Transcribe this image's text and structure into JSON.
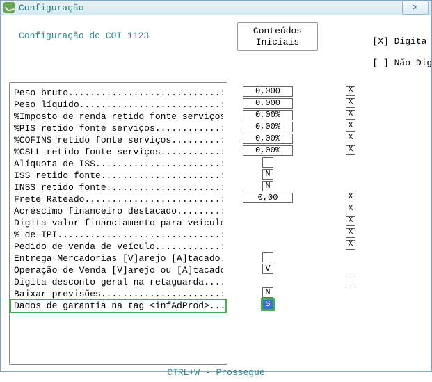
{
  "window": {
    "title": "Configuração",
    "close_glyph": "✕"
  },
  "page_title": "Configuração do COI 1123",
  "column_headers": {
    "conteudos_line1": "Conteúdos",
    "conteudos_line2": "Iniciais",
    "legend_line1": "[X] Digita",
    "legend_line2": "[ ] Não Digita"
  },
  "rows": [
    {
      "label": "Peso bruto............................:",
      "value": "0,000",
      "value_kind": "wide",
      "flag": "X"
    },
    {
      "label": "Peso líquido..........................:",
      "value": "0,000",
      "value_kind": "wide",
      "flag": "X"
    },
    {
      "label": "%Imposto de renda retido fonte serviços:",
      "value": "0,00%",
      "value_kind": "wide",
      "flag": "X"
    },
    {
      "label": "%PIS retido fonte serviços............:",
      "value": "0,00%",
      "value_kind": "wide",
      "flag": "X"
    },
    {
      "label": "%COFINS retido fonte serviços.........:",
      "value": "0,00%",
      "value_kind": "wide",
      "flag": "X"
    },
    {
      "label": "%CSLL retido fonte serviços...........:",
      "value": "0,00%",
      "value_kind": "wide",
      "flag": "X"
    },
    {
      "label": "Alíquota de ISS.......................:",
      "value": "",
      "value_kind": "narrow",
      "flag": ""
    },
    {
      "label": "ISS retido fonte......................:",
      "value": "N",
      "value_kind": "narrow",
      "flag": ""
    },
    {
      "label": "INSS retido fonte.....................:",
      "value": "N",
      "value_kind": "narrow",
      "flag": ""
    },
    {
      "label": "Frete Rateado.........................:",
      "value": "0,00",
      "value_kind": "wide",
      "flag": "X"
    },
    {
      "label": "Acréscimo financeiro destacado........:",
      "value": "",
      "value_kind": "none",
      "flag": "X"
    },
    {
      "label": "Digita valor financiamento para veículo:",
      "value": "",
      "value_kind": "none",
      "flag": "X"
    },
    {
      "label": "% de IPI..............................:",
      "value": "",
      "value_kind": "none",
      "flag": "X"
    },
    {
      "label": "Pedido de venda de veículo............:",
      "value": "",
      "value_kind": "none",
      "flag": "X"
    },
    {
      "label": "Entrega Mercadorias [V]arejo [A]tacado.:",
      "value": "",
      "value_kind": "narrow",
      "flag": ""
    },
    {
      "label": "Operação de Venda [V]arejo ou [A]tacado:",
      "value": "V",
      "value_kind": "narrow",
      "flag": ""
    },
    {
      "label": "Digita desconto geral na retaguarda....:",
      "value": "",
      "value_kind": "none",
      "flag": " "
    },
    {
      "label": "Baixar previsões......................:",
      "value": "N",
      "value_kind": "narrow",
      "flag": ""
    },
    {
      "label": "Dados de garantia na tag <infAdProd>...:",
      "value": "S",
      "value_kind": "narrow",
      "flag": "",
      "highlight": true,
      "active": true
    }
  ],
  "footer": "CTRL+W - Prossegue"
}
